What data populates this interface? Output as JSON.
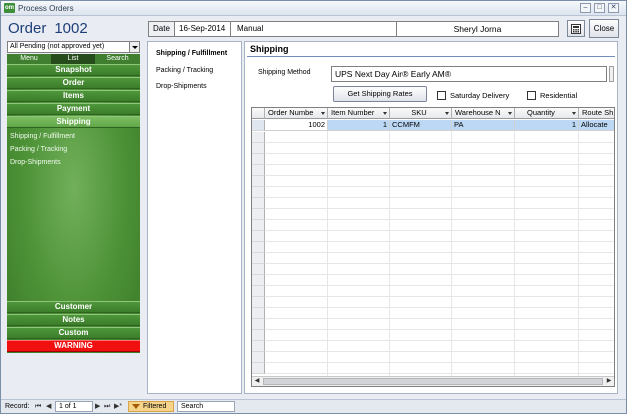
{
  "window": {
    "title": "Process Orders",
    "app_icon": "om",
    "controls": [
      "–",
      "□",
      "✕"
    ]
  },
  "header": {
    "order_label": "Order",
    "order_number": "1002",
    "date_label": "Date",
    "date_value": "16-Sep-2014",
    "type_value": "Manual",
    "user_name": "Sheryl Jorna",
    "close_label": "Close"
  },
  "filter": {
    "selected": "All Pending (not approved yet)"
  },
  "nav": {
    "tabs": [
      "Menu",
      "List",
      "Search"
    ],
    "active_tab": "List",
    "buttons_top": [
      "Snapshot",
      "Order",
      "Items",
      "Payment",
      "Shipping"
    ],
    "active_button": "Shipping",
    "sub_items": [
      "Shipping / Fulfillment",
      "Packing / Tracking",
      "Drop-Shipments"
    ],
    "buttons_bottom": [
      "Customer",
      "Notes",
      "Custom"
    ],
    "warning_label": "WARNING",
    "colors": {
      "nav_green": "#4c9136",
      "active_green": "#6aaf50",
      "warning_red": "#f01010"
    }
  },
  "subnav": {
    "items": [
      "Shipping / Fulfillment",
      "Packing / Tracking",
      "Drop-Shipments"
    ],
    "active": "Shipping / Fulfillment"
  },
  "main": {
    "section_title": "Shipping",
    "shipping_method_label": "Shipping Method",
    "shipping_method_value": "UPS Next Day Air® Early AM®",
    "get_rates_label": "Get Shipping Rates",
    "saturday_delivery_label": "Saturday Delivery",
    "saturday_delivery_checked": false,
    "residential_label": "Residential",
    "residential_checked": false
  },
  "grid": {
    "columns": [
      "Order Numbe",
      "Item Number",
      "SKU",
      "Warehouse N",
      "Quantity",
      "Route Sh"
    ],
    "rows": [
      [
        "1002",
        "1",
        "CCMFM",
        "PA",
        "1",
        "Allocate"
      ]
    ],
    "selection_color": "#bcd8f4"
  },
  "status": {
    "record_label": "Record:",
    "first": "⏮",
    "prev": "◀",
    "position": "1 of 1",
    "next": "▶",
    "last": "⏭",
    "new": "▶*",
    "filtered_label": "Filtered",
    "search_label": "Search"
  }
}
